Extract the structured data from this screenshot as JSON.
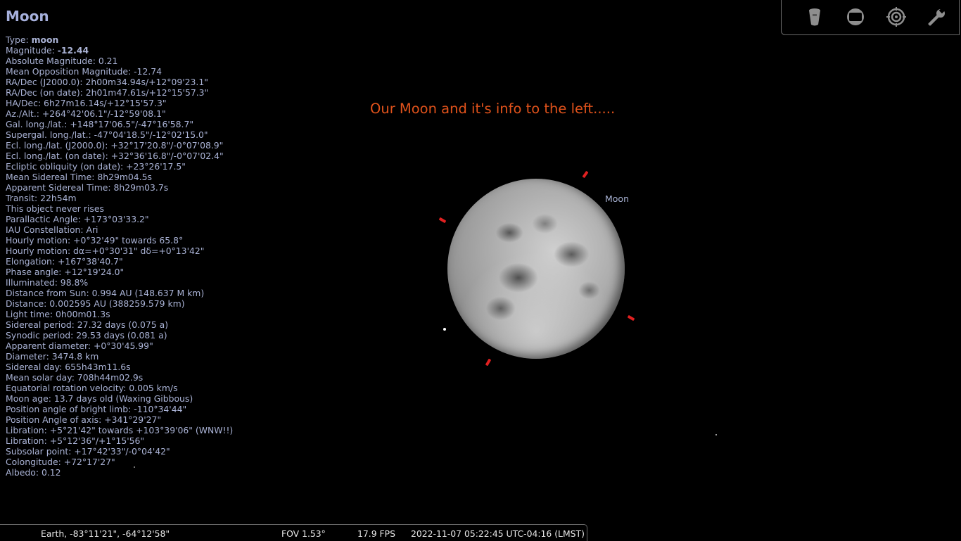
{
  "object": {
    "title": "Moon",
    "lines": [
      {
        "label": "Type: ",
        "value": "moon"
      },
      {
        "label": "Magnitude: ",
        "value": "-12.44"
      },
      {
        "text": "Absolute Magnitude: 0.21"
      },
      {
        "text": "Mean Opposition Magnitude: -12.74"
      },
      {
        "text": "RA/Dec (J2000.0): 2h00m34.94s/+12°09'23.1\""
      },
      {
        "text": "RA/Dec (on date): 2h01m47.61s/+12°15'57.3\""
      },
      {
        "text": "HA/Dec: 6h27m16.14s/+12°15'57.3\""
      },
      {
        "text": "Az./Alt.: +264°42'06.1\"/-12°59'08.1\""
      },
      {
        "text": "Gal. long./lat.: +148°17'06.5\"/-47°16'58.7\""
      },
      {
        "text": "Supergal. long./lat.: -47°04'18.5\"/-12°02'15.0\""
      },
      {
        "text": "Ecl. long./lat. (J2000.0): +32°17'20.8\"/-0°07'08.9\""
      },
      {
        "text": "Ecl. long./lat. (on date): +32°36'16.8\"/-0°07'02.4\""
      },
      {
        "text": "Ecliptic obliquity (on date): +23°26'17.5\""
      },
      {
        "text": "Mean Sidereal Time: 8h29m04.5s"
      },
      {
        "text": "Apparent Sidereal Time: 8h29m03.7s"
      },
      {
        "text": "Transit: 22h54m"
      },
      {
        "text": "This object never rises"
      },
      {
        "text": "Parallactic Angle: +173°03'33.2\""
      },
      {
        "text": "IAU Constellation: Ari"
      },
      {
        "text": "Hourly motion: +0°32'49\" towards 65.8°"
      },
      {
        "text": "Hourly motion: dα=+0°30'31\" dδ=+0°13'42\""
      },
      {
        "text": "Elongation: +167°38'40.7\""
      },
      {
        "text": "Phase angle: +12°19'24.0\""
      },
      {
        "text": "Illuminated: 98.8%"
      },
      {
        "text": "Distance from Sun: 0.994 AU (148.637 M km)"
      },
      {
        "text": "Distance: 0.002595 AU (388259.579 km)"
      },
      {
        "text": "Light time: 0h00m01.3s"
      },
      {
        "text": "Sidereal period: 27.32 days (0.075 a)"
      },
      {
        "text": "Synodic period: 29.53 days (0.081 a)"
      },
      {
        "text": "Apparent diameter: +0°30'45.99\""
      },
      {
        "text": "Diameter: 3474.8 km"
      },
      {
        "text": "Sidereal day: 655h43m11.6s"
      },
      {
        "text": "Mean solar day: 708h44m02.9s"
      },
      {
        "text": "Equatorial rotation velocity: 0.005 km/s"
      },
      {
        "text": "Moon age: 13.7 days old (Waxing Gibbous)"
      },
      {
        "text": "Position angle of bright limb: -110°34'44\""
      },
      {
        "text": "Position Angle of axis: +341°29'27\""
      },
      {
        "text": "Libration: +5°21'42\" towards +103°39'06\" (WNW!!)"
      },
      {
        "text": "Libration: +5°12'36\"/+1°15'56\""
      },
      {
        "text": "Subsolar point: +17°42'33\"/-0°04'42\""
      },
      {
        "text": "Colongitude: +72°17'27\""
      },
      {
        "text": "Albedo: 0.12"
      }
    ]
  },
  "annotation": "Our Moon and it's info to the left.....",
  "sky": {
    "moon_label": "Moon"
  },
  "toolbar": {
    "icons": [
      "telescope-icon",
      "ocular-icon",
      "sensor-icon",
      "wrench-icon"
    ]
  },
  "status": {
    "location": "Earth, -83°11'21\", -64°12'58\"",
    "fov": "FOV 1.53°",
    "fps": "17.9 FPS",
    "datetime": "2022-11-07 05:22:45 UTC-04:16 (LMST)"
  },
  "colors": {
    "info_text": "#aab3d6",
    "annotation": "#e0521b",
    "marker": "#e02020",
    "background": "#000000"
  }
}
